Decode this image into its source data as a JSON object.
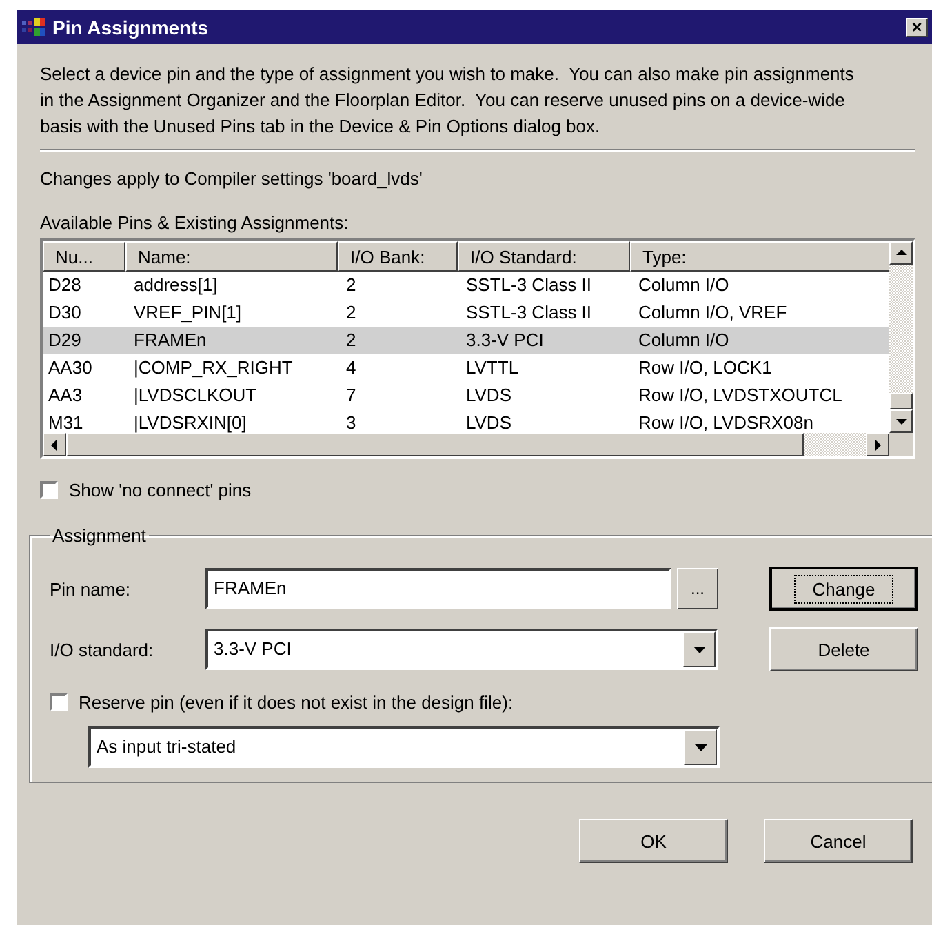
{
  "window": {
    "title": "Pin Assignments",
    "close": "×"
  },
  "description": "Select a device pin and the type of assignment you wish to make.  You can also make pin assignments in the Assignment Organizer and the Floorplan Editor.  You can reserve unused pins on a device-wide basis with the Unused Pins tab in the Device & Pin Options dialog box.",
  "compiler_note": "Changes apply to Compiler settings 'board_lvds'",
  "list_label": "Available Pins & Existing Assignments:",
  "table": {
    "columns": [
      "Nu...",
      "Name:",
      "I/O Bank:",
      "I/O Standard:",
      "Type:"
    ],
    "rows": [
      {
        "cells": [
          "D28",
          "address[1]",
          "2",
          "SSTL-3 Class II",
          "Column I/O"
        ],
        "selected": false
      },
      {
        "cells": [
          "D30",
          "VREF_PIN[1]",
          "2",
          "SSTL-3 Class II",
          "Column I/O, VREF"
        ],
        "selected": false
      },
      {
        "cells": [
          "D29",
          "FRAMEn",
          "2",
          "3.3-V PCI",
          "Column I/O"
        ],
        "selected": true
      },
      {
        "cells": [
          "AA30",
          "|COMP_RX_RIGHT",
          "4",
          "LVTTL",
          "Row I/O, LOCK1"
        ],
        "selected": false
      },
      {
        "cells": [
          "AA3",
          "|LVDSCLKOUT",
          "7",
          "LVDS",
          "Row I/O, LVDSTXOUTCL"
        ],
        "selected": false
      },
      {
        "cells": [
          "M31",
          "|LVDSRXIN[0]",
          "3",
          "LVDS",
          "Row I/O, LVDSRX08n"
        ],
        "selected": false
      }
    ]
  },
  "show_no_connect": {
    "label": "Show 'no connect' pins",
    "checked": false
  },
  "assignment": {
    "title": "Assignment",
    "pin_name": {
      "label": "Pin name:",
      "value": "FRAMEn",
      "browse": "..."
    },
    "io_standard": {
      "label": "I/O standard:",
      "value": "3.3-V PCI"
    },
    "reserve": {
      "label": "Reserve pin (even if it does not exist in the design file):",
      "checked": false
    },
    "reserve_mode": {
      "value": "As input tri-stated"
    },
    "buttons": [
      {
        "label": "Change",
        "focused": true
      },
      {
        "label": "Delete",
        "focused": false
      }
    ]
  },
  "buttons": [
    "OK",
    "Cancel"
  ]
}
